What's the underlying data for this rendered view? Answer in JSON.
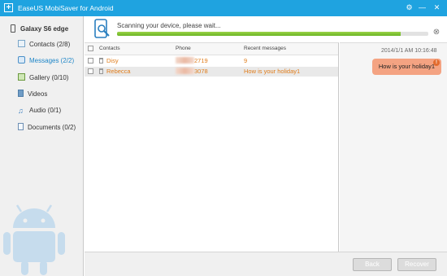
{
  "window": {
    "title": "EaseUS MobiSaver for Android",
    "app_icon": "+",
    "controls": {
      "settings": "⚙",
      "minimize": "—",
      "close": "✕"
    }
  },
  "sidebar": {
    "device_name": "Galaxy S6 edge",
    "items": [
      {
        "label": "Contacts (2/8)",
        "icon": "contacts-icon"
      },
      {
        "label": "Messages (2/2)",
        "icon": "messages-icon",
        "active": true
      },
      {
        "label": "Gallery (0/10)",
        "icon": "gallery-icon"
      },
      {
        "label": "Videos",
        "icon": "videos-icon"
      },
      {
        "label": "Audio (0/1)",
        "icon": "audio-icon"
      },
      {
        "label": "Documents (0/2)",
        "icon": "documents-icon"
      }
    ]
  },
  "scan": {
    "status_text": "Scanning your device, please wait...",
    "progress": 0.91,
    "close_symbol": "⊗"
  },
  "table": {
    "columns": [
      "Contacts",
      "Phone",
      "Recent messages"
    ],
    "rows": [
      {
        "contact": "Disy",
        "phone_suffix": "2719",
        "recent": "9"
      },
      {
        "contact": "Rebecca",
        "phone_suffix": "3078",
        "recent": "How is your holiday1"
      }
    ]
  },
  "detail": {
    "timestamp": "2014/1/1   AM 10:16:48",
    "message": "How is your holiday1",
    "warn_symbol": "!"
  },
  "buttons": {
    "back": "Back",
    "recover": "Recover"
  },
  "colors": {
    "titlebar": "#1fa3e0",
    "accent_text": "#e07c1a",
    "active_nav": "#1e86c8",
    "bubble": "#f4a382",
    "progress": "#7cbf2e"
  }
}
